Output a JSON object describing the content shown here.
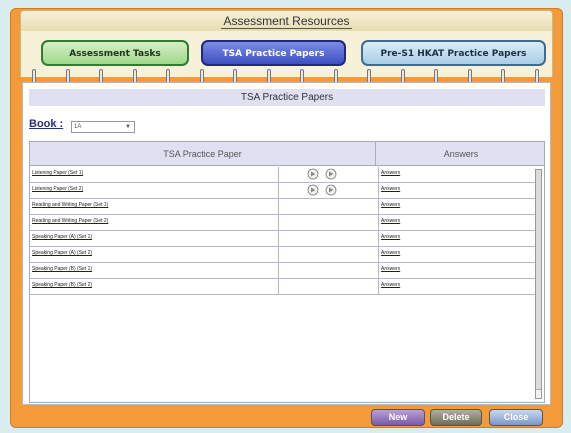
{
  "window": {
    "title": "Assessment Resources"
  },
  "tabs": [
    {
      "label": "Assessment Tasks",
      "active": false
    },
    {
      "label": "TSA Practice Papers",
      "active": true
    },
    {
      "label": "Pre-S1 HKAT Practice Papers",
      "active": false
    }
  ],
  "section": {
    "title": "TSA Practice Papers"
  },
  "book": {
    "label": "Book :",
    "value": "1A"
  },
  "table": {
    "headers": {
      "paper": "TSA Practice Paper",
      "answers": "Answers"
    },
    "rows": [
      {
        "paper": "Listening Paper (Set 1)",
        "audio": true,
        "answers": "Answers"
      },
      {
        "paper": "Listening Paper (Set 2)",
        "audio": true,
        "answers": "Answers"
      },
      {
        "paper": "Reading and Writing Paper (Set 1)",
        "audio": false,
        "answers": "Answers"
      },
      {
        "paper": "Reading and Writing Paper (Set 2)",
        "audio": false,
        "answers": "Answers"
      },
      {
        "paper": "Speaking Paper (A) (Set 1)",
        "audio": false,
        "answers": "Answers"
      },
      {
        "paper": "Speaking Paper (A) (Set 2)",
        "audio": false,
        "answers": "Answers"
      },
      {
        "paper": "Speaking Paper (B) (Set 1)",
        "audio": false,
        "answers": "Answers"
      },
      {
        "paper": "Speaking Paper (B) (Set 2)",
        "audio": false,
        "answers": "Answers"
      }
    ]
  },
  "buttons": {
    "new": "New",
    "delete": "Delete",
    "close": "Close"
  },
  "colors": {
    "frame": "#f39a3a",
    "active_tab": "#3d4fc0",
    "header_bg": "#dfe1f3"
  }
}
